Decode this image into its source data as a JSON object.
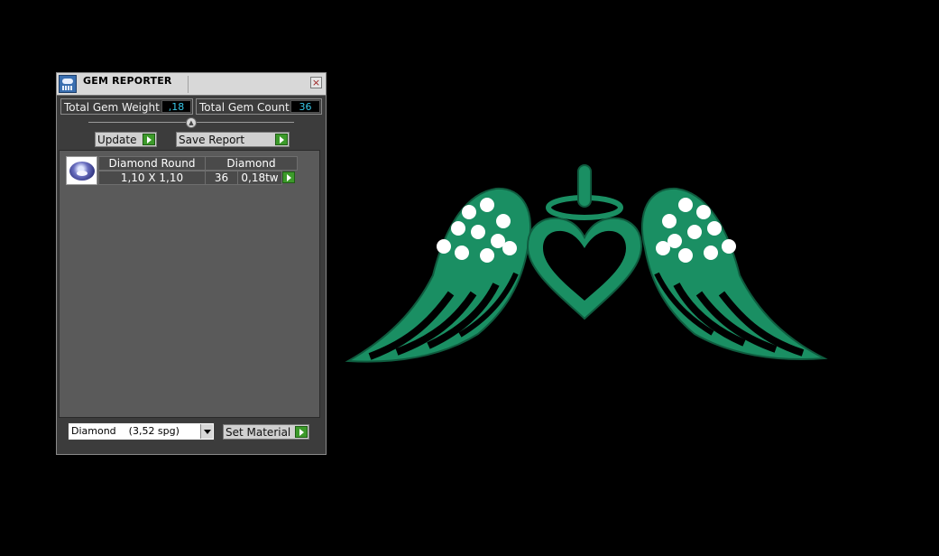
{
  "window": {
    "title": "GEM REPORTER",
    "close_glyph": "×",
    "icon": "gem-reporter-icon"
  },
  "summary": {
    "weight_label": "Total Gem Weight",
    "weight_value": ",18",
    "count_label": "Total Gem Count",
    "count_value": "36"
  },
  "toolbar": {
    "update_label": "Update",
    "save_report_label": "Save Report"
  },
  "gem_list": [
    {
      "shape": "Diamond Round",
      "material": "Diamond",
      "size": "1,10 X 1,10",
      "count": "36",
      "weight": "0,18tw"
    }
  ],
  "material_select": {
    "selected": "Diamond    (3,52 spg)",
    "set_label": "Set Material"
  },
  "viewport": {
    "model_color": "#1a8f63",
    "gem_color": "#ffffff"
  }
}
